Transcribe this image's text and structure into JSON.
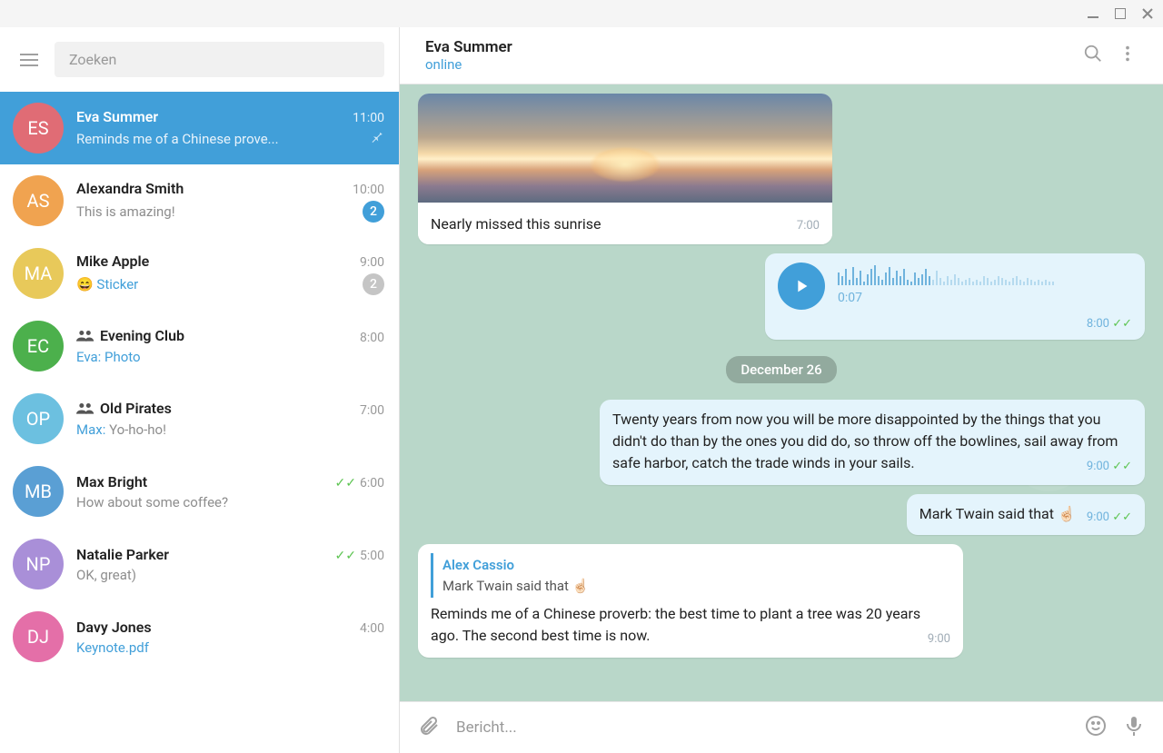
{
  "search_placeholder": "Zoeken",
  "chats": [
    {
      "initials": "ES",
      "color": "#e06c75",
      "name": "Eva Summer",
      "time": "11:00",
      "preview": "Reminds me of a Chinese prove...",
      "pinned": true,
      "active": true
    },
    {
      "initials": "AS",
      "color": "#f0a350",
      "name": "Alexandra Smith",
      "time": "10:00",
      "preview": "This is amazing!",
      "badge": "2"
    },
    {
      "initials": "MA",
      "color": "#e8c95a",
      "name": "Mike Apple",
      "time": "9:00",
      "preview_emoji": "😄",
      "preview_link": "Sticker",
      "badge": "2",
      "badge_muted": true
    },
    {
      "initials": "EC",
      "color": "#4cb04c",
      "name": "Evening Club",
      "time": "8:00",
      "group": true,
      "preview_sender": "Eva: ",
      "preview_link": "Photo"
    },
    {
      "initials": "OP",
      "color": "#6cc0e0",
      "name": "Old Pirates",
      "time": "7:00",
      "group": true,
      "preview_sender": "Max: ",
      "preview_rest": "Yo-ho-ho!"
    },
    {
      "initials": "MB",
      "color": "#5a9fd4",
      "name": "Max Bright",
      "time": "6:00",
      "checks": true,
      "preview": "How about some coffee?"
    },
    {
      "initials": "NP",
      "color": "#a98fd8",
      "name": "Natalie Parker",
      "time": "5:00",
      "checks": true,
      "preview": "OK, great)"
    },
    {
      "initials": "DJ",
      "color": "#e46fa8",
      "name": "Davy Jones",
      "time": "4:00",
      "preview_link": "Keynote.pdf"
    }
  ],
  "header": {
    "name": "Eva Summer",
    "status": "online"
  },
  "photo_caption": "Nearly missed this sunrise",
  "photo_time": "7:00",
  "voice": {
    "duration": "0:07",
    "time": "8:00"
  },
  "date_separator": "December 26",
  "msg_quote": {
    "text": "Twenty years from now you will be more disappointed by the things that you didn't do than by the ones you did do, so throw off the bowlines, sail away from safe harbor, catch the trade winds in your sails.",
    "time": "9:00"
  },
  "msg_twain": {
    "text": "Mark Twain said that ",
    "time": "9:00"
  },
  "msg_reply": {
    "reply_name": "Alex Cassio",
    "reply_text": "Mark Twain said that ",
    "text": "Reminds me of a Chinese proverb: the best time to plant a tree was 20 years ago. The second best time is now.",
    "time": "9:00"
  },
  "hand_emoji": "☝🏻",
  "compose_placeholder": "Bericht..."
}
